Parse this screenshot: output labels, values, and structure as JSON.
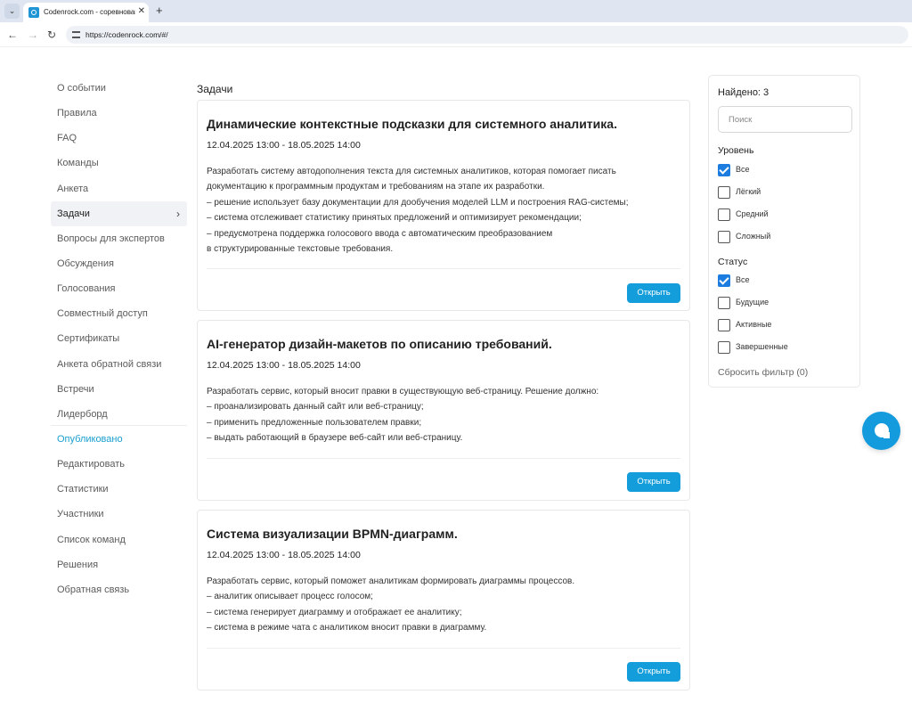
{
  "browser": {
    "tab_title": "Codenrock.com - соревнования",
    "tab_close": "✕",
    "new_tab": "+",
    "url": "https://codenrock.com/#/",
    "back": "←",
    "forward": "→",
    "reload": "↻",
    "menu_icon": "⌄"
  },
  "sidebar": {
    "items": [
      {
        "label": "О событии"
      },
      {
        "label": "Правила"
      },
      {
        "label": "FAQ"
      },
      {
        "label": "Команды"
      },
      {
        "label": "Анкета"
      },
      {
        "label": "Задачи",
        "active": true
      },
      {
        "label": "Вопросы для экспертов"
      },
      {
        "label": "Обсуждения"
      },
      {
        "label": "Голосования"
      },
      {
        "label": "Совместный доступ"
      },
      {
        "label": "Сертификаты"
      },
      {
        "label": "Анкета обратной связи"
      },
      {
        "label": "Встречи"
      },
      {
        "label": "Лидерборд"
      },
      {
        "label": "Опубликовано",
        "accent": "#1aa0cf"
      },
      {
        "label": "Редактировать"
      },
      {
        "label": "Статистики"
      },
      {
        "label": "Участники"
      },
      {
        "label": "Список команд"
      },
      {
        "label": "Решения"
      },
      {
        "label": "Обратная связь"
      }
    ],
    "active_chevron": "›"
  },
  "main": {
    "section_title": "Задачи",
    "open_button_label": "Открыть",
    "tasks": [
      {
        "title": "Динамические контекстные подсказки для системного аналитика.",
        "dates": "12.04.2025 13:00 - 18.05.2025 14:00",
        "description": [
          "Разработать систему автодополнения текста для системных аналитиков, которая помогает писать",
          "документацию к программным продуктам и требованиям на этапе их разработки.",
          "– решение использует базу документации для дообучения моделей LLM и построения RAG-системы;",
          "– система отслеживает статистику принятых предложений и оптимизирует рекомендации;",
          "– предусмотрена поддержка голосового ввода с автоматическим преобразованием",
          "в структурированные текстовые требования."
        ]
      },
      {
        "title": "AI-генератор дизайн-макетов по описанию требований.",
        "dates": "12.04.2025 13:00 - 18.05.2025 14:00",
        "description": [
          "Разработать сервис, который вносит правки в существующую веб-страницу. Решение должно:",
          "– проанализировать данный сайт или веб-страницу;",
          "– применить предложенные пользователем правки;",
          "– выдать работающий в браузере веб-сайт или веб-страницу."
        ]
      },
      {
        "title": "Система визуализации BPMN-диаграмм.",
        "dates": "12.04.2025 13:00 - 18.05.2025 14:00",
        "description": [
          "Разработать сервис, который поможет аналитикам формировать диаграммы процессов.",
          "– аналитик описывает процесс голосом;",
          "– система генерирует диаграмму и отображает ее аналитику;",
          "– система в режиме чата с аналитиком вносит правки в диаграмму."
        ]
      }
    ]
  },
  "filter": {
    "found": "Найдено: 3",
    "search_placeholder": "Поиск",
    "level_title": "Уровень",
    "level_options": [
      {
        "label": "Все",
        "checked": true
      },
      {
        "label": "Лёгкий",
        "checked": false
      },
      {
        "label": "Средний",
        "checked": false
      },
      {
        "label": "Сложный",
        "checked": false
      }
    ],
    "status_title": "Статус",
    "status_options": [
      {
        "label": "Все",
        "checked": true
      },
      {
        "label": "Будущие",
        "checked": false
      },
      {
        "label": "Активные",
        "checked": false
      },
      {
        "label": "Завершенные",
        "checked": false
      }
    ],
    "reset_label": "Сбросить фильтр (0)"
  },
  "colors": {
    "accent": "#139ddb",
    "checkbox_checked": "#1c7ce0",
    "published_link": "#1aa0cf"
  },
  "chat": {
    "icon": "chat-bubble-icon"
  }
}
